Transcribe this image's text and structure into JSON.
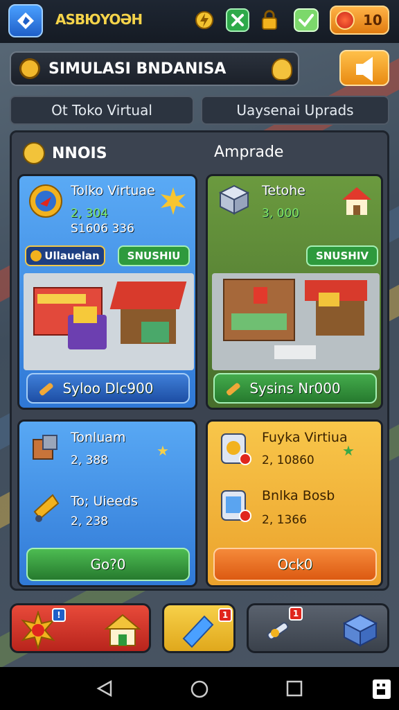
{
  "top_bar": {
    "app_title": "ASBЮYOƏH",
    "icons": [
      "lightning-icon",
      "clover-icon",
      "lock-icon",
      "check-icon"
    ],
    "coin_count": "10"
  },
  "banner": {
    "title": "SIMULASI BNDANISA"
  },
  "tabs": [
    "Ot Toko Virtual",
    "Uaysenai Uprads"
  ],
  "panel": {
    "left_heading": "NNOIS",
    "right_heading": "Amprade"
  },
  "cards": {
    "store_blue": {
      "name": "Tolko Virtuae",
      "value1": "2, 304",
      "value2": "S1606 336",
      "tag_label": "Ullauelan",
      "status_label": "SNUSHIU",
      "action_label": "Syloo Dlc900"
    },
    "store_green": {
      "name": "Tetohe",
      "value1": "3, 000",
      "status_label": "SNUSHIV",
      "action_label": "Sysins Nr000"
    },
    "items_blue": {
      "item1_name": "Tonluam",
      "item1_value": "2, 388",
      "item2_name": "To; Uieeds",
      "item2_value": "2, 238",
      "button_label": "Go?0"
    },
    "items_orange": {
      "item1_name": "Fuyka Virtiua",
      "item1_value": "2, 10860",
      "item2_name": "Bnlka Bosb",
      "item2_value": "2, 1366",
      "button_label": "Ock0"
    }
  },
  "bottom_bar": {
    "badges": [
      "!",
      "1",
      "1"
    ]
  },
  "colors": {
    "blue_card": "#3f8fe6",
    "green_card": "#5e8e3c",
    "orange_card": "#f4b63a",
    "green_button": "#2e9a3d",
    "orange_button": "#e86a1a",
    "red_button": "#d8322c",
    "yellow_button": "#f2c434"
  }
}
